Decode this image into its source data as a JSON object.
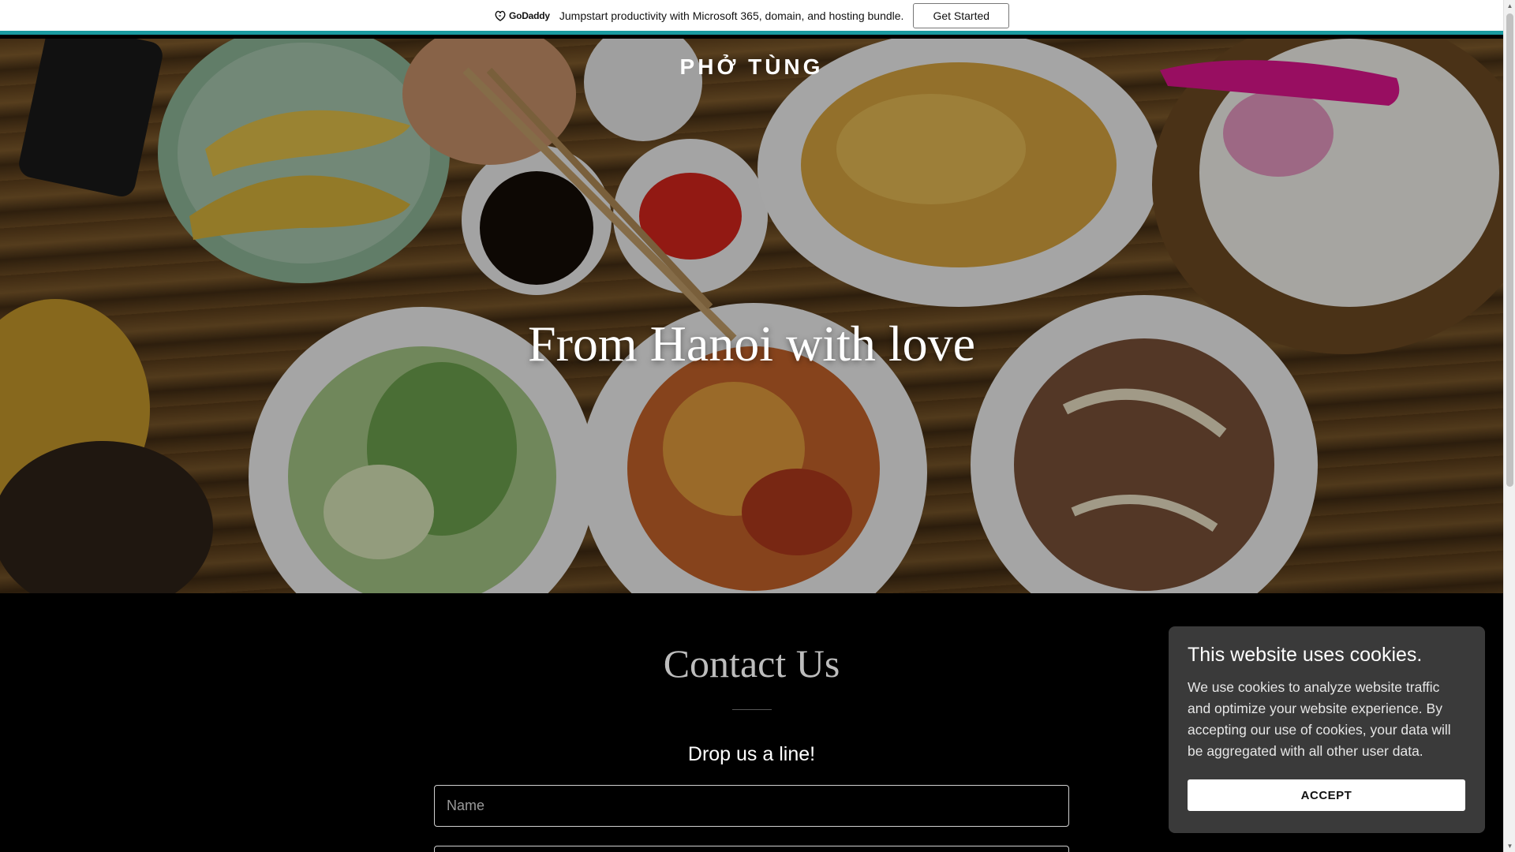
{
  "promo": {
    "logo_text": "GoDaddy",
    "message": "Jumpstart productivity with Microsoft 365, domain, and hosting bundle.",
    "cta_label": "Get Started",
    "accent_color": "#1a9aa0"
  },
  "hero": {
    "brand": "PHỞ TÙNG",
    "tagline": "From Hanoi with love"
  },
  "contact": {
    "title": "Contact Us",
    "subtitle": "Drop us a line!",
    "name_placeholder": "Name"
  },
  "cookie": {
    "title": "This website uses cookies.",
    "body": "We use cookies to analyze website traffic and optimize your website experience. By accepting our use of cookies, your data will be aggregated with all other user data.",
    "accept_label": "ACCEPT"
  },
  "icons": {
    "godaddy": "godaddy-logo-icon",
    "scroll_up": "scroll-up-arrow-icon",
    "scroll_down": "scroll-down-arrow-icon"
  }
}
